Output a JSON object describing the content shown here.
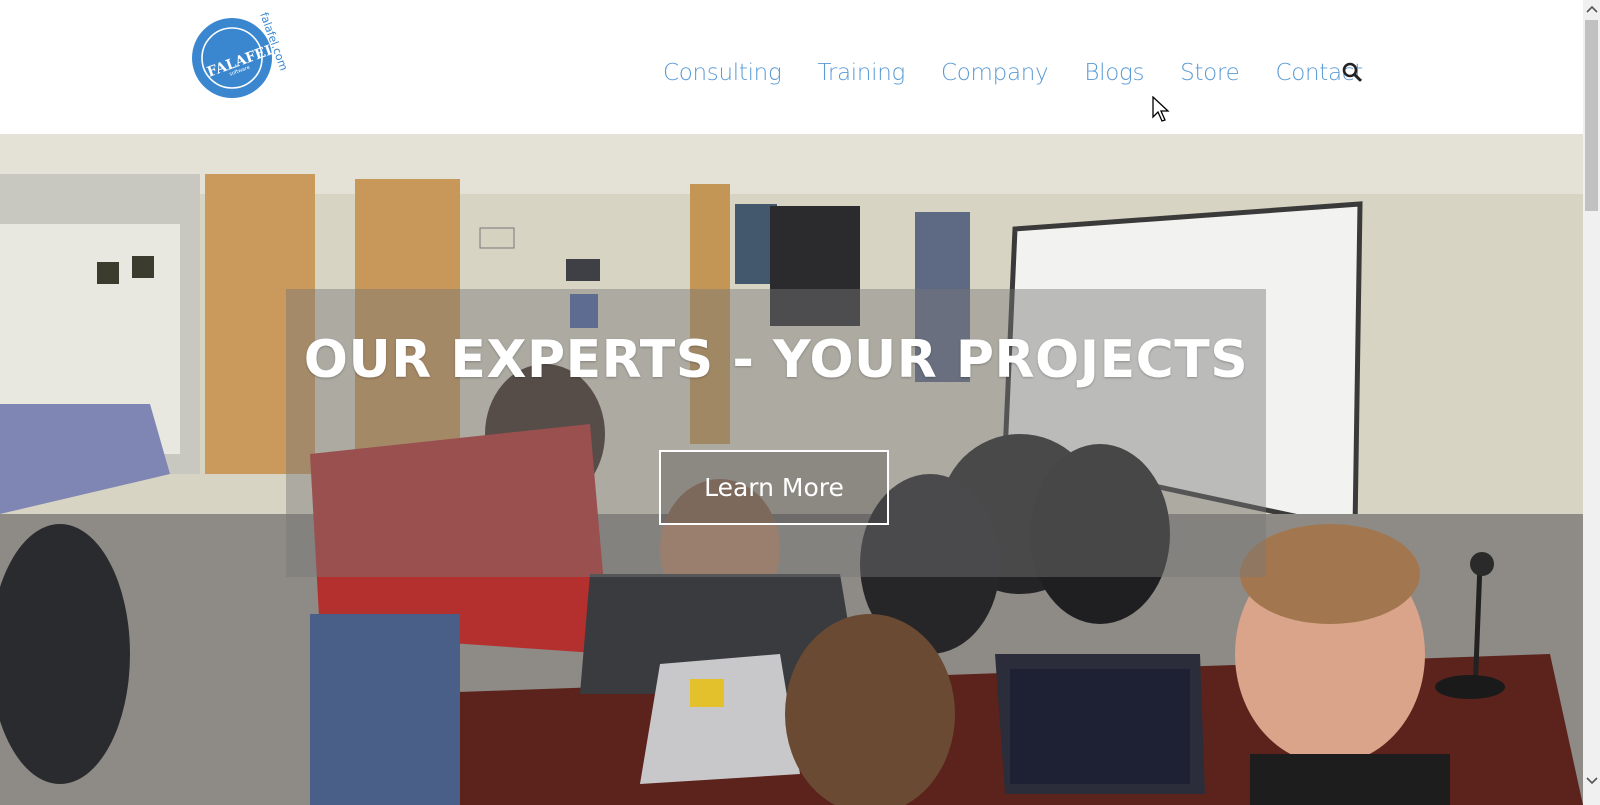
{
  "header": {
    "logo": {
      "name": "falafel-software-logo",
      "wordmark": "FALAFEL",
      "tagline": "software",
      "domain": "falafel.com",
      "color": "#3a87d0"
    },
    "nav": [
      {
        "label": "Consulting"
      },
      {
        "label": "Training"
      },
      {
        "label": "Company"
      },
      {
        "label": "Blogs"
      },
      {
        "label": "Store"
      },
      {
        "label": "Contact"
      }
    ],
    "search_icon": "search-icon",
    "nav_color": "#5b9bd5"
  },
  "hero": {
    "title": "OUR EXPERTS - YOUR PROJECTS",
    "button_label": "Learn More",
    "background": "office-team-photo"
  }
}
